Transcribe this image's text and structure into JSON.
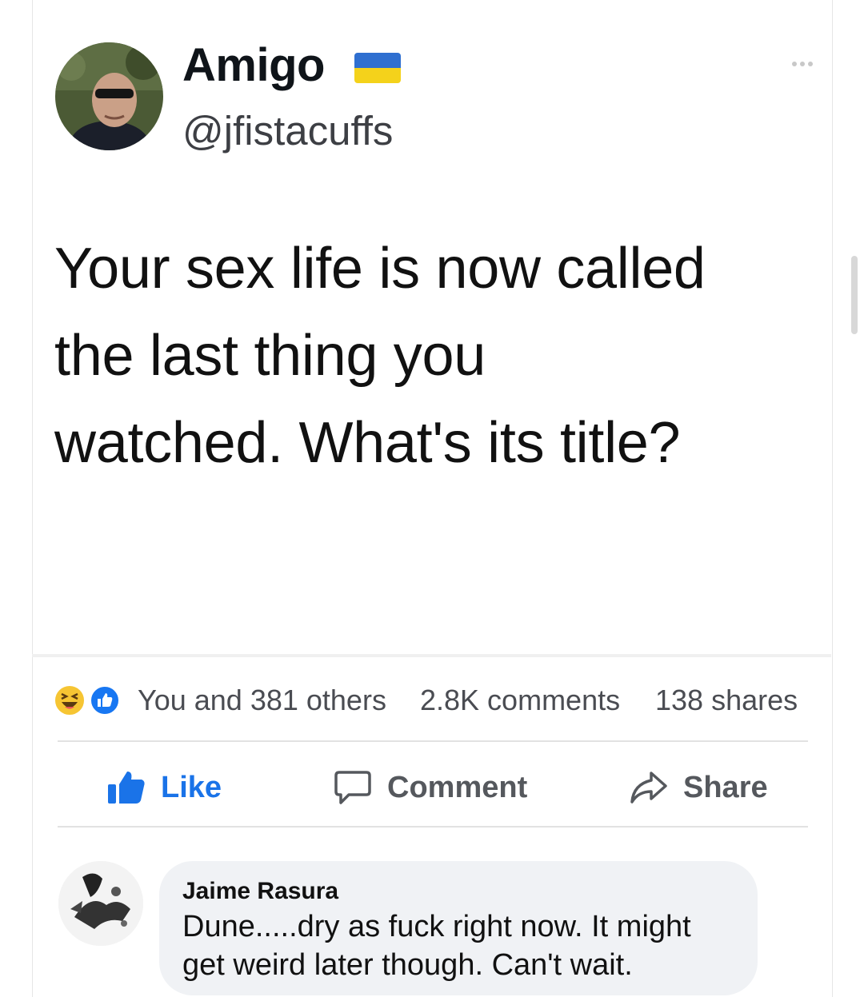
{
  "tweet": {
    "display_name": "Amigo",
    "handle": "@jfistacuffs",
    "flag_icon": "ukraine-flag-icon",
    "more_icon": "more-dots-icon",
    "text_lines": [
      "Your sex life is now called",
      "the last thing you",
      "watched. What's its title?"
    ]
  },
  "reactions": {
    "icons": [
      "haha-reaction-icon",
      "like-reaction-icon"
    ],
    "summary": "You and 381 others",
    "comments": "2.8K comments",
    "shares": "138 shares"
  },
  "actions": {
    "like": "Like",
    "comment": "Comment",
    "share": "Share"
  },
  "comment": {
    "author": "Jaime Rasura",
    "text_lines": [
      "Dune.....dry as fuck right now. It might",
      "get weird later though. Can't wait."
    ]
  },
  "colors": {
    "facebook_blue": "#1877f2",
    "flag_blue": "#2f6fd0",
    "flag_yellow": "#f4d21b",
    "bubble_bg": "#f0f2f5"
  }
}
